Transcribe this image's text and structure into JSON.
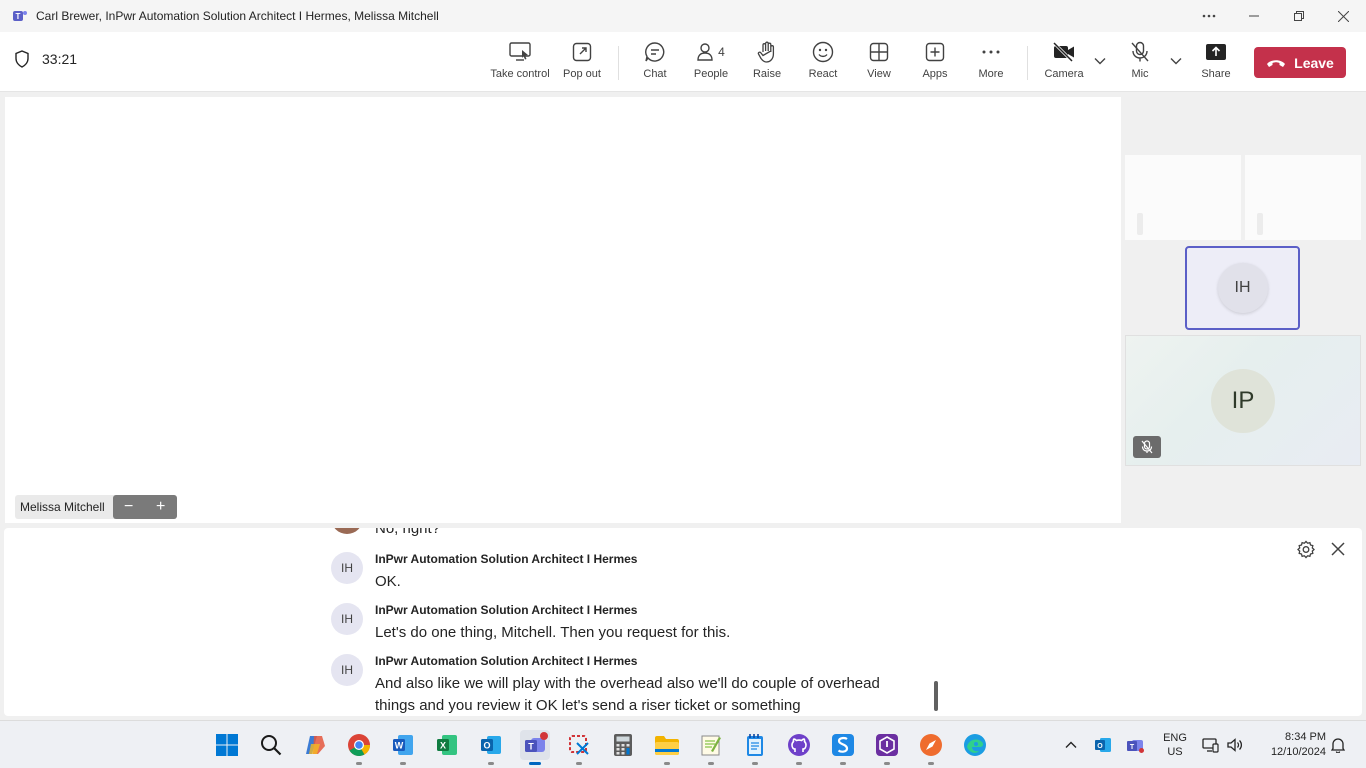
{
  "window": {
    "title": "Carl Brewer, InPwr Automation Solution Architect I Hermes, Melissa Mitchell"
  },
  "toolbar": {
    "timer": "33:21",
    "take_control": "Take control",
    "pop_out": "Pop out",
    "chat": "Chat",
    "people": "People",
    "people_count": "4",
    "raise": "Raise",
    "react": "React",
    "view": "View",
    "apps": "Apps",
    "more": "More",
    "camera": "Camera",
    "mic": "Mic",
    "share": "Share",
    "leave": "Leave"
  },
  "stage": {
    "presenter_name": "Melissa Mitchell",
    "zoom_out": "−",
    "zoom_in": "+"
  },
  "participants": [
    {
      "initials": "IH"
    },
    {
      "initials": "IP"
    }
  ],
  "captions": {
    "partial_text": "No, right?",
    "messages": [
      {
        "initials": "IH",
        "speaker": "InPwr Automation Solution Architect I Hermes",
        "text": "OK."
      },
      {
        "initials": "IH",
        "speaker": "InPwr Automation Solution Architect I Hermes",
        "text": "Let's do one thing, Mitchell. Then you request for this."
      },
      {
        "initials": "IH",
        "speaker": "InPwr Automation Solution Architect I Hermes",
        "text": "And also like we will play with the overhead also we'll do couple of overhead things and you review it OK let's send a riser ticket or something"
      }
    ]
  },
  "taskbar": {
    "language": "ENG",
    "region": "US",
    "time": "8:34 PM",
    "date": "12/10/2024",
    "accent": "#0067c0"
  },
  "colors": {
    "leave": "#c4314b",
    "teams_purple": "#5b5fc7"
  }
}
